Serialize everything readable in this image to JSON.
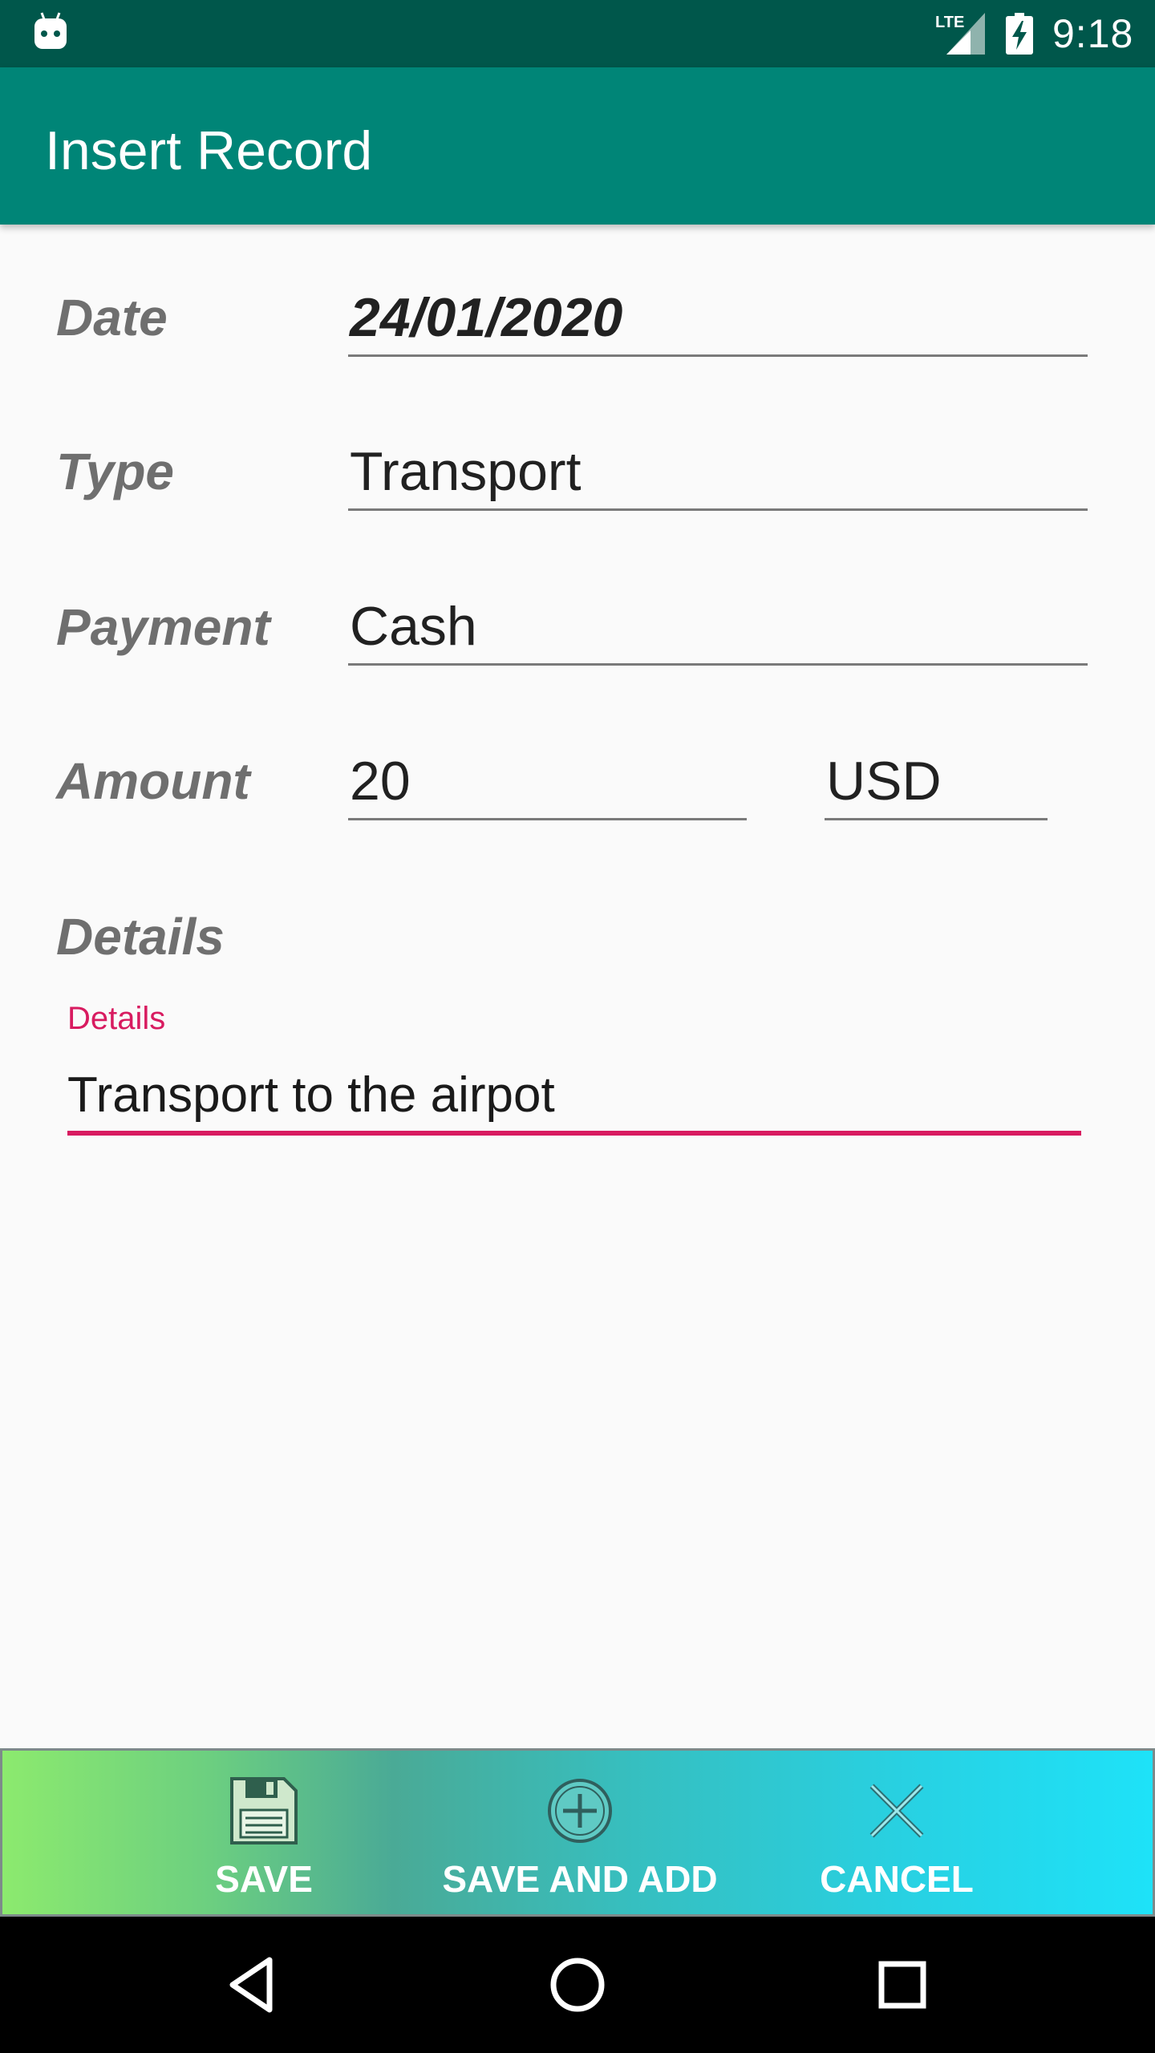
{
  "status_bar": {
    "time": "9:18",
    "network_label": "LTE",
    "icons": [
      "android-icon",
      "lte-signal-icon",
      "battery-charging-icon"
    ]
  },
  "app_bar": {
    "title": "Insert Record"
  },
  "form": {
    "date": {
      "label": "Date",
      "value": "24/01/2020"
    },
    "type": {
      "label": "Type",
      "value": "Transport"
    },
    "payment": {
      "label": "Payment",
      "value": "Cash"
    },
    "amount": {
      "label": "Amount",
      "value": "20",
      "currency": "USD"
    },
    "details": {
      "label": "Details",
      "floating_label": "Details",
      "value": "Transport to the airpot"
    }
  },
  "actions": {
    "save": {
      "label": "SAVE",
      "icon": "floppy-disk-icon"
    },
    "save_and_add": {
      "label": "SAVE AND ADD",
      "icon": "plus-circle-icon"
    },
    "cancel": {
      "label": "CANCEL",
      "icon": "close-icon"
    }
  },
  "colors": {
    "status_bar": "#00574b",
    "app_bar": "#008577",
    "accent": "#d81b60",
    "action_gradient_start": "#8cea6e",
    "action_gradient_end": "#1ee2f8"
  },
  "nav_bar": {
    "buttons": [
      "back-icon",
      "home-icon",
      "recents-icon"
    ]
  }
}
